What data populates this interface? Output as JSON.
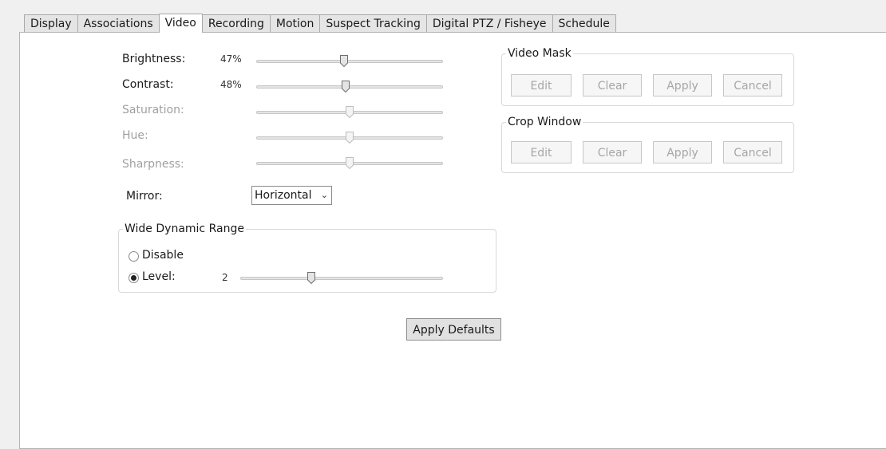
{
  "tabs": [
    {
      "label": "Display"
    },
    {
      "label": "Associations"
    },
    {
      "label": "Video",
      "active": true
    },
    {
      "label": "Recording"
    },
    {
      "label": "Motion"
    },
    {
      "label": "Suspect Tracking"
    },
    {
      "label": "Digital PTZ / Fisheye"
    },
    {
      "label": "Schedule"
    }
  ],
  "sliders": [
    {
      "label": "Brightness:",
      "value_text": "47%",
      "value": 47,
      "enabled": true
    },
    {
      "label": "Contrast:",
      "value_text": "48%",
      "value": 48,
      "enabled": true
    },
    {
      "label": "Saturation:",
      "value_text": "",
      "value": 50,
      "enabled": false
    },
    {
      "label": "Hue:",
      "value_text": "",
      "value": 50,
      "enabled": false
    },
    {
      "label": "Sharpness:",
      "value_text": "",
      "value": 50,
      "enabled": false
    }
  ],
  "mirror": {
    "label": "Mirror:",
    "selected": "Horizontal"
  },
  "wdr": {
    "title": "Wide Dynamic Range",
    "disable_label": "Disable",
    "level_label": "Level:",
    "level_value": "2",
    "level_fraction": 0.35,
    "selected": "level"
  },
  "video_mask": {
    "title": "Video Mask",
    "buttons": {
      "edit": "Edit",
      "clear": "Clear",
      "apply": "Apply",
      "cancel": "Cancel"
    }
  },
  "crop_window": {
    "title": "Crop Window",
    "buttons": {
      "edit": "Edit",
      "clear": "Clear",
      "apply": "Apply",
      "cancel": "Cancel"
    }
  },
  "apply_defaults_label": "Apply Defaults",
  "colors": {
    "panel_bg": "#ffffff",
    "page_bg": "#f0f0f0",
    "disabled_text": "#a0a0a0"
  }
}
